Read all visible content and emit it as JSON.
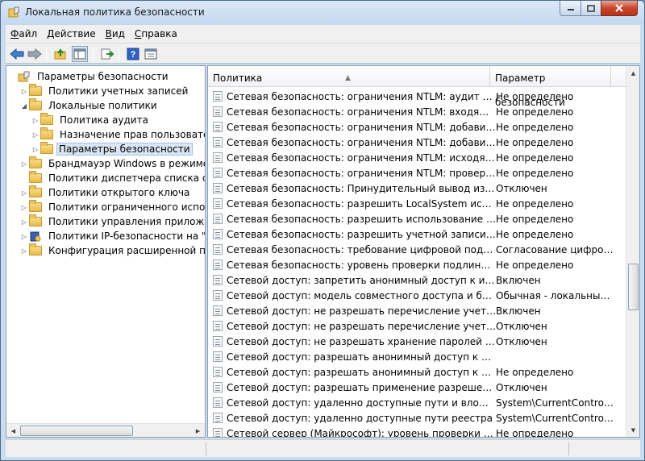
{
  "window": {
    "title": "Локальная политика безопасности"
  },
  "menu": [
    {
      "accel": "Ф",
      "rest": "айл"
    },
    {
      "accel": "Д",
      "rest": "ействие"
    },
    {
      "accel": "В",
      "rest": "ид"
    },
    {
      "accel": "С",
      "rest": "правка"
    }
  ],
  "toolbar": {
    "icons": [
      "back-icon",
      "forward-icon",
      "up-folder-icon",
      "show-tree-icon",
      "export-list-icon",
      "help-icon",
      "properties-icon"
    ]
  },
  "tree": [
    {
      "label": "Параметры безопасности",
      "indent": 0,
      "arrow": "",
      "icon": "security-root-icon"
    },
    {
      "label": "Политики учетных записей",
      "indent": 1,
      "arrow": "▷",
      "icon": "folder-icon"
    },
    {
      "label": "Локальные политики",
      "indent": 1,
      "arrow": "◢",
      "icon": "folder-icon"
    },
    {
      "label": "Политика аудита",
      "indent": 2,
      "arrow": "▷",
      "icon": "folder-icon"
    },
    {
      "label": "Назначение прав пользователя",
      "indent": 2,
      "arrow": "▷",
      "icon": "folder-icon"
    },
    {
      "label": "Параметры безопасности",
      "indent": 2,
      "arrow": "▷",
      "icon": "folder-icon",
      "selected": true
    },
    {
      "label": "Брандмауэр Windows в режиме пов",
      "indent": 1,
      "arrow": "▷",
      "icon": "folder-icon"
    },
    {
      "label": "Политики диспетчера списка сетей",
      "indent": 1,
      "arrow": "",
      "icon": "folder-icon"
    },
    {
      "label": "Политики открытого ключа",
      "indent": 1,
      "arrow": "▷",
      "icon": "folder-icon"
    },
    {
      "label": "Политики ограниченного использо",
      "indent": 1,
      "arrow": "▷",
      "icon": "folder-icon"
    },
    {
      "label": "Политики управления приложения",
      "indent": 1,
      "arrow": "▷",
      "icon": "folder-icon"
    },
    {
      "label": "Политики IP-безопасности на \"Лока",
      "indent": 1,
      "arrow": "▷",
      "icon": "ipsec-icon"
    },
    {
      "label": "Конфигурация расширенной полит",
      "indent": 1,
      "arrow": "▷",
      "icon": "folder-icon"
    }
  ],
  "list": {
    "headers": {
      "policy": "Политика",
      "setting": "Параметр безопасности"
    },
    "rows": [
      {
        "policy": "Сетевая безопасность: ограничения NTLM: аудит проверки подлинности NTLM",
        "setting": "Не определено"
      },
      {
        "policy": "Сетевая безопасность: ограничения NTLM: входящий трафик NTLM",
        "setting": "Не определено"
      },
      {
        "policy": "Сетевая безопасность: ограничения NTLM: добавить исключения серверов",
        "setting": "Не определено"
      },
      {
        "policy": "Сетевая безопасность: ограничения NTLM: добавить удаленные серверы",
        "setting": "Не определено"
      },
      {
        "policy": "Сетевая безопасность: ограничения NTLM: исходящий трафик NTLM",
        "setting": "Не определено"
      },
      {
        "policy": "Сетевая безопасность: ограничения NTLM: проверка подлинности NTLM",
        "setting": "Не определено"
      },
      {
        "policy": "Сетевая безопасность: Принудительный вывод из сеанса",
        "setting": "Отключен"
      },
      {
        "policy": "Сетевая безопасность: разрешить LocalSystem использовать",
        "setting": "Не определено"
      },
      {
        "policy": "Сетевая безопасность: разрешить использование сетевых удостоверений",
        "setting": "Не определено"
      },
      {
        "policy": "Сетевая безопасность: разрешить учетной записи локальной системы",
        "setting": "Не определено"
      },
      {
        "policy": "Сетевая безопасность: требование цифровой подписи для клиента",
        "setting": "Согласование цифровой подписи"
      },
      {
        "policy": "Сетевая безопасность: уровень проверки подлинности LAN Manager",
        "setting": "Не определено"
      },
      {
        "policy": "Сетевой доступ: запретить анонимный доступ к именованным каналам",
        "setting": "Включен"
      },
      {
        "policy": "Сетевой доступ: модель совместного доступа и безопасности",
        "setting": "Обычная - локальные пользователи"
      },
      {
        "policy": "Сетевой доступ: не разрешать перечисление учетных записей",
        "setting": "Включен"
      },
      {
        "policy": "Сетевой доступ: не разрешать перечисление учетных записей SAM",
        "setting": "Отключен"
      },
      {
        "policy": "Сетевой доступ: не разрешать хранение паролей или учетных данных",
        "setting": "Отключен"
      },
      {
        "policy": "Сетевой доступ: разрешать анонимный доступ к именованным каналам",
        "setting": ""
      },
      {
        "policy": "Сетевой доступ: разрешать анонимный доступ к общим ресурсам",
        "setting": "Не определено"
      },
      {
        "policy": "Сетевой доступ: разрешать применение разрешений \"Для всех\"",
        "setting": "Отключен"
      },
      {
        "policy": "Сетевой доступ: удаленно доступные пути и вложенные пути реестра",
        "setting": "System\\CurrentControlSet\\"
      },
      {
        "policy": "Сетевой доступ: удаленно доступные пути реестра",
        "setting": "System\\CurrentControlSet\\"
      },
      {
        "policy": "Сетевой сервер (Майкрософт): уровень проверки сервером",
        "setting": "Не определено"
      }
    ]
  },
  "colors": {
    "selection": "#d9e6f5",
    "window_frame": "#c9dcf0"
  }
}
